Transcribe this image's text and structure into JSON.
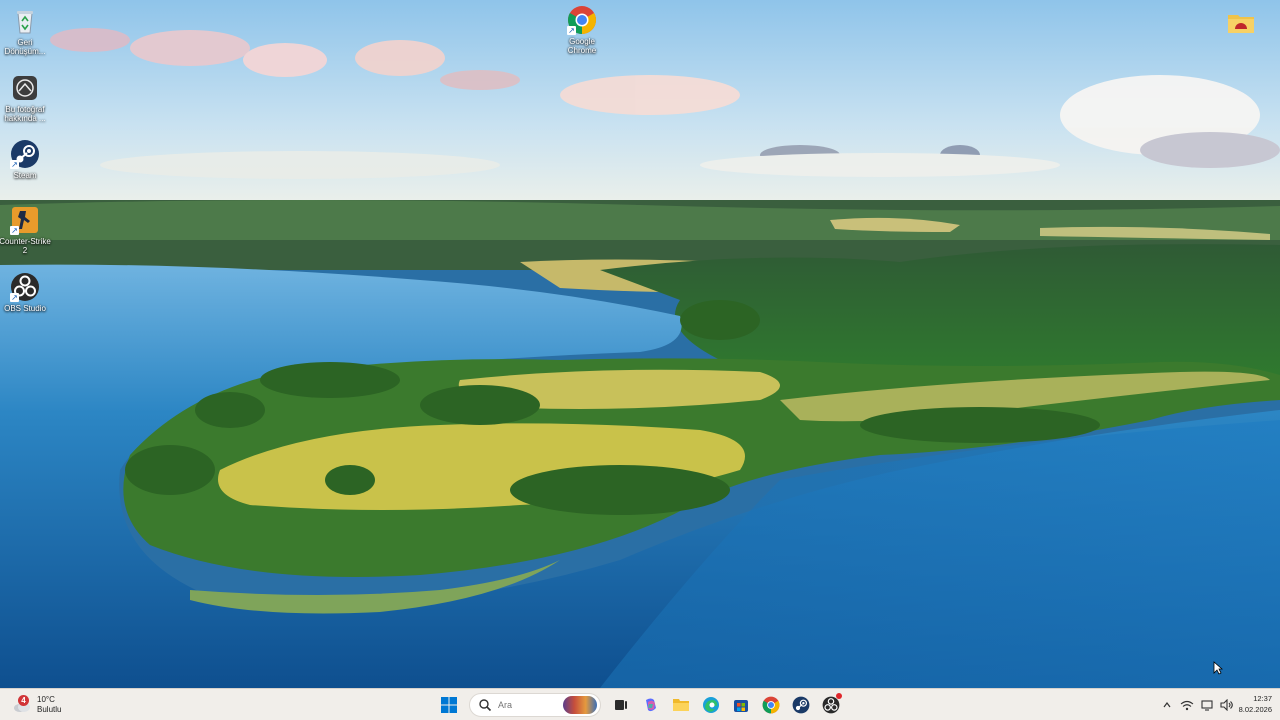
{
  "desktop": {
    "icons": [
      {
        "label": "Geri Dönüşüm...",
        "icon": "recycle-bin-icon"
      },
      {
        "label": "Bu fotoğraf hakkında ...",
        "icon": "spotlight-icon"
      },
      {
        "label": "Steam",
        "icon": "steam-icon"
      },
      {
        "label": "Counter-Strike 2",
        "icon": "counter-strike-icon"
      },
      {
        "label": "OBS Studio",
        "icon": "obs-icon"
      },
      {
        "label": "Google Chrome",
        "icon": "chrome-icon"
      },
      {
        "label": "",
        "icon": "folder-icon"
      }
    ]
  },
  "taskbar": {
    "weather": {
      "badge": "4",
      "temperature": "10°C",
      "condition": "Bulutlu"
    },
    "search": {
      "placeholder": "Ara"
    },
    "pinned": [
      "start-icon",
      "search",
      "task-view-icon",
      "copilot-icon",
      "file-explorer-icon",
      "edge-icon",
      "store-icon",
      "chrome-icon",
      "steam-icon",
      "obs-icon"
    ],
    "tray": [
      "chevron-up-icon",
      "network-icon",
      "display-icon",
      "volume-icon"
    ],
    "clock": {
      "time": "12:37",
      "date": "8.02.2026"
    }
  },
  "colors": {
    "taskbar_bg": "#f1eeea",
    "accent": "#0078d4",
    "sky": "#a9d3ee",
    "lake": "#1d6aa8",
    "field": "#c9c24a"
  }
}
